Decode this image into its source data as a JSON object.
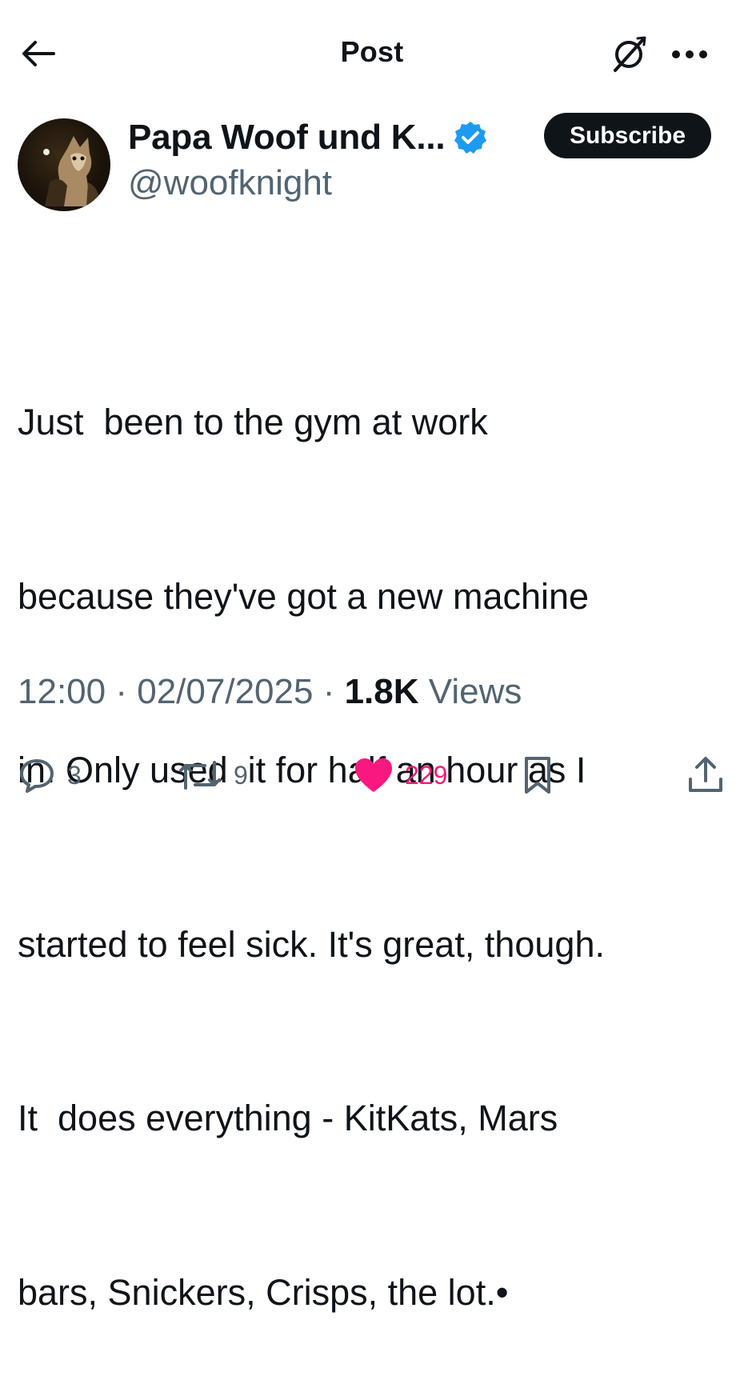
{
  "header": {
    "title": "Post",
    "back_icon": "arrow-left-icon",
    "grok_icon": "grok-icon",
    "more_icon": "more-dots-icon"
  },
  "author": {
    "display_name": "Papa Woof und K...",
    "handle": "@woofknight",
    "verified": true,
    "verified_color": "#1d9bf0",
    "subscribe_label": "Subscribe"
  },
  "tweet": {
    "lines": [
      "Just  been to the gym at work",
      "because they've got a new machine",
      "in. Only used  it for half an hour as I",
      "started to feel sick. It's great, though.",
      "It  does everything - KitKats, Mars",
      "bars, Snickers, Crisps, the lot.•"
    ]
  },
  "meta": {
    "time": "12:00",
    "date": "02/07/2025",
    "separator": "·",
    "views_count": "1.8K",
    "views_label": "Views"
  },
  "actions": {
    "replies": "3",
    "reposts": "9",
    "likes": "229",
    "like_color": "#f91880",
    "liked": true
  }
}
